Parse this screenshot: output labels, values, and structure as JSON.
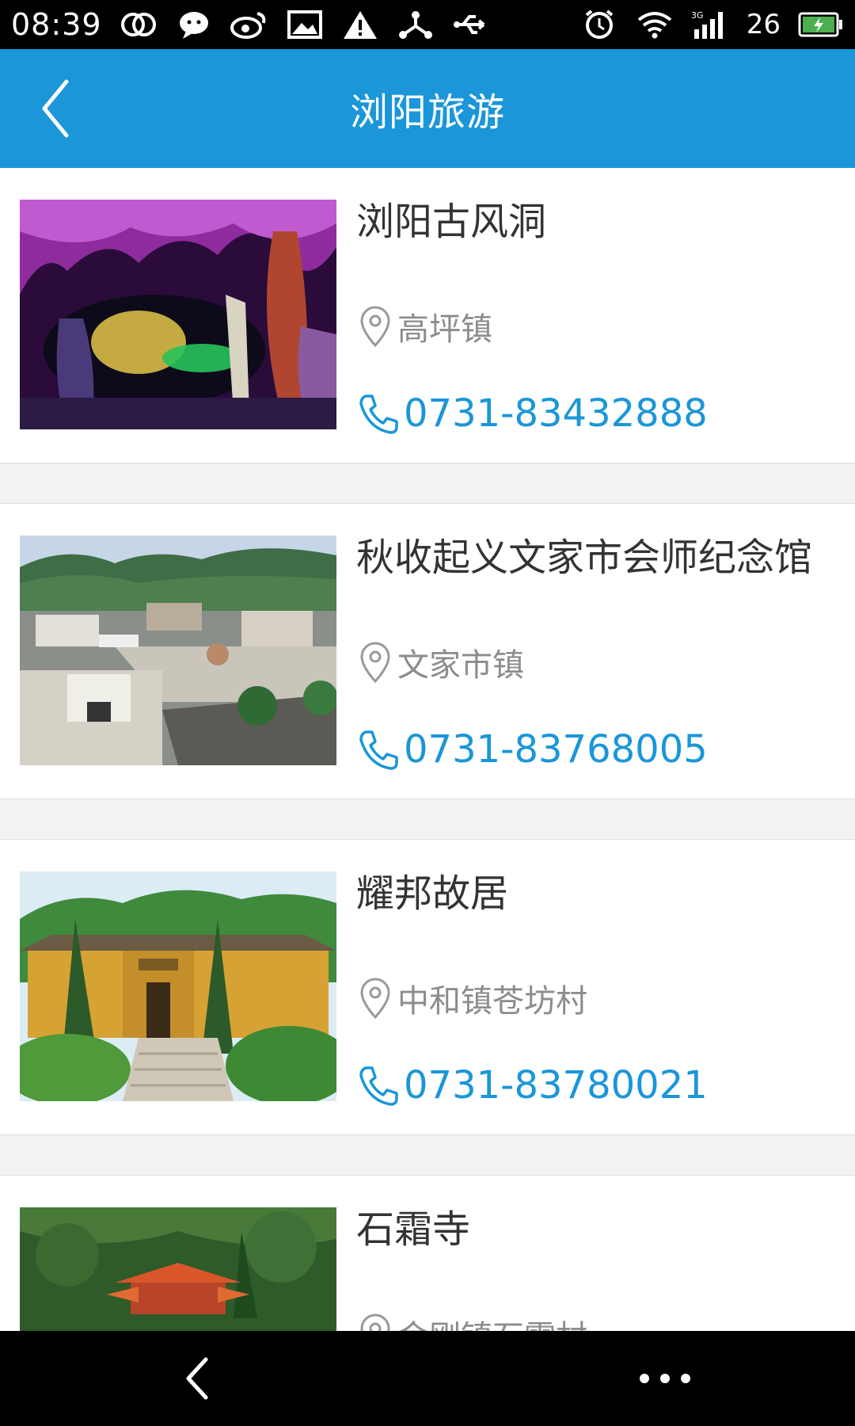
{
  "status_bar": {
    "time": "08:39",
    "signal_strength": "26",
    "network_type": "3G",
    "icons": [
      "double-ring-icon",
      "chat-bubble-icon",
      "weibo-icon",
      "image-icon",
      "warning-icon",
      "share-node-icon",
      "usb-icon",
      "alarm-icon",
      "wifi-icon",
      "signal-icon",
      "battery-charging-icon"
    ]
  },
  "header": {
    "title": "浏阳旅游",
    "back_icon": "chevron-left-icon"
  },
  "spots": [
    {
      "name": "浏阳古风洞",
      "location": "高坪镇",
      "phone": "0731-83432888",
      "image": "cave-photo"
    },
    {
      "name": "秋收起义文家市会师纪念馆",
      "location": "文家市镇",
      "phone": "0731-83768005",
      "image": "memorial-square-photo"
    },
    {
      "name": "耀邦故居",
      "location": "中和镇苍坊村",
      "phone": "0731-83780021",
      "image": "yellow-house-photo"
    },
    {
      "name": "石霜寺",
      "location": "金刚镇石霜村",
      "phone": "",
      "image": "temple-photo"
    }
  ],
  "nav_bar": {
    "back_icon": "nav-back-icon",
    "menu_icon": "more-dots-icon"
  },
  "colors": {
    "accent": "#1a96d9",
    "status_bar": "#000000",
    "background": "#f2f2f2"
  }
}
